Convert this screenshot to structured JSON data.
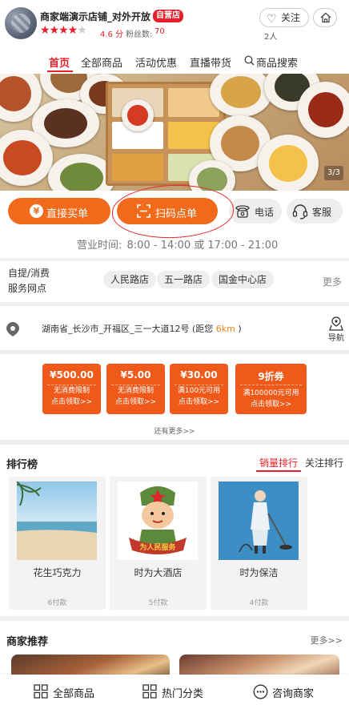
{
  "header": {
    "shop_name": "商家端演示店铺_对外开放",
    "self_badge": "自营店",
    "stars_filled": "★★★★",
    "stars_empty": "★",
    "rating": "4.6 分",
    "fans_label": "粉丝数:",
    "fans_count": "70",
    "follow_label": "关注",
    "follow_count": "2人"
  },
  "tabs": [
    {
      "label": "首页",
      "active": true
    },
    {
      "label": "全部商品"
    },
    {
      "label": "活动优惠"
    },
    {
      "label": "直播带货"
    },
    {
      "label": "商品搜索"
    }
  ],
  "banner": {
    "page_indicator": "3/3"
  },
  "actions": {
    "buy_label": "直接买单",
    "buy_icon_glyph": "¥",
    "scan_label": "扫码点单",
    "phone_label": "电话",
    "service_label": "客服",
    "hours_label": "营业时间:",
    "hours_value": "8:00 - 14:00 或 17:00 - 21:00"
  },
  "service_points": {
    "label": "自提/消费服务网点",
    "chips": [
      "人民路店",
      "五一路店",
      "国金中心店"
    ],
    "more": "更多"
  },
  "address": {
    "text": "湖南省_长沙市_开福区_三一大道12号 (距您",
    "distance": "6km",
    "suffix": ")",
    "nav_label": "导航"
  },
  "coupons": {
    "items": [
      {
        "amount": "¥500.00",
        "condition": "无消费限制",
        "claim": "点击领取>>"
      },
      {
        "amount": "¥5.00",
        "condition": "无消费限制",
        "claim": "点击领取>>"
      },
      {
        "amount": "¥30.00",
        "condition": "满100元可用",
        "claim": "点击领取>>"
      },
      {
        "amount": "9折券",
        "condition": "满100000元可用",
        "claim": "点击领取>>"
      }
    ],
    "more": "还有更多>>"
  },
  "ranking": {
    "title": "排行榜",
    "tab_sales": "销量排行",
    "tab_follow": "关注排行",
    "items": [
      {
        "name": "花生巧克力",
        "sales": "6付款"
      },
      {
        "name": "时为大酒店",
        "sales": "5付款",
        "image_text": "为人民服务"
      },
      {
        "name": "时为保洁",
        "sales": "4付款"
      }
    ]
  },
  "recommend": {
    "title": "商家推荐",
    "more": "更多>>"
  },
  "bottom_nav": {
    "all_goods": "全部商品",
    "hot_categories": "热门分类",
    "consult": "咨询商家"
  },
  "colors": {
    "accent_red": "#e5202a",
    "orange": "#f26a1b",
    "coupon": "#ef5a1a"
  },
  "icons": [
    "heart-plus-icon",
    "home-icon",
    "search-icon",
    "yen-icon",
    "scan-icon",
    "phone-icon",
    "headset-icon",
    "location-pin-icon",
    "navigation-icon",
    "grid-icon",
    "chat-icon"
  ]
}
